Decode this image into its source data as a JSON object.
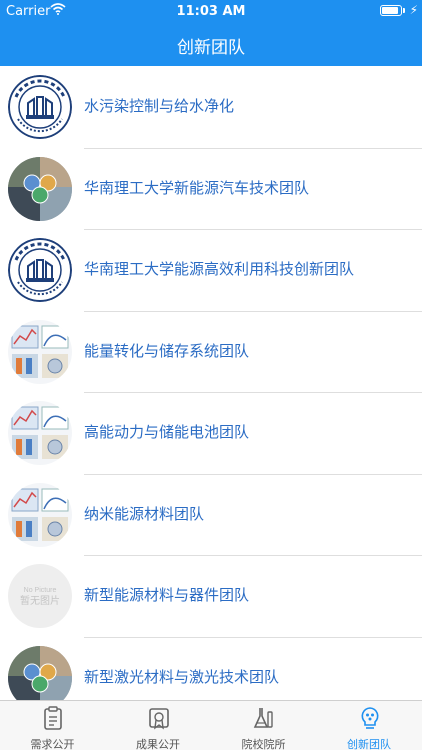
{
  "status": {
    "carrier": "Carrier",
    "time": "11:03 AM",
    "battery_level": 0.9
  },
  "navbar": {
    "title": "创新团队"
  },
  "teams": [
    {
      "label": "水污染控制与给水净化",
      "thumb": "university-logo"
    },
    {
      "label": "华南理工大学新能源汽车技术团队",
      "thumb": "photo-collage"
    },
    {
      "label": "华南理工大学能源高效利用科技创新团队",
      "thumb": "university-logo"
    },
    {
      "label": "能量转化与储存系统团队",
      "thumb": "research-figure"
    },
    {
      "label": "高能动力与储能电池团队",
      "thumb": "research-figure"
    },
    {
      "label": "纳米能源材料团队",
      "thumb": "research-figure"
    },
    {
      "label": "新型能源材料与器件团队",
      "thumb": "no-picture",
      "placeholder_en": "No Picture",
      "placeholder_zh": "暂无图片"
    },
    {
      "label": "新型激光材料与激光技术团队",
      "thumb": "photo-collage"
    }
  ],
  "tabbar": {
    "items": [
      {
        "label": "需求公开",
        "icon": "clipboard-icon",
        "active": false
      },
      {
        "label": "成果公开",
        "icon": "certificate-icon",
        "active": false
      },
      {
        "label": "院校院所",
        "icon": "lab-flask-icon",
        "active": false
      },
      {
        "label": "创新团队",
        "icon": "lightbulb-team-icon",
        "active": true
      }
    ]
  },
  "colors": {
    "primary": "#1e90f0",
    "link": "#2b6cc4",
    "separator": "#dedede"
  }
}
